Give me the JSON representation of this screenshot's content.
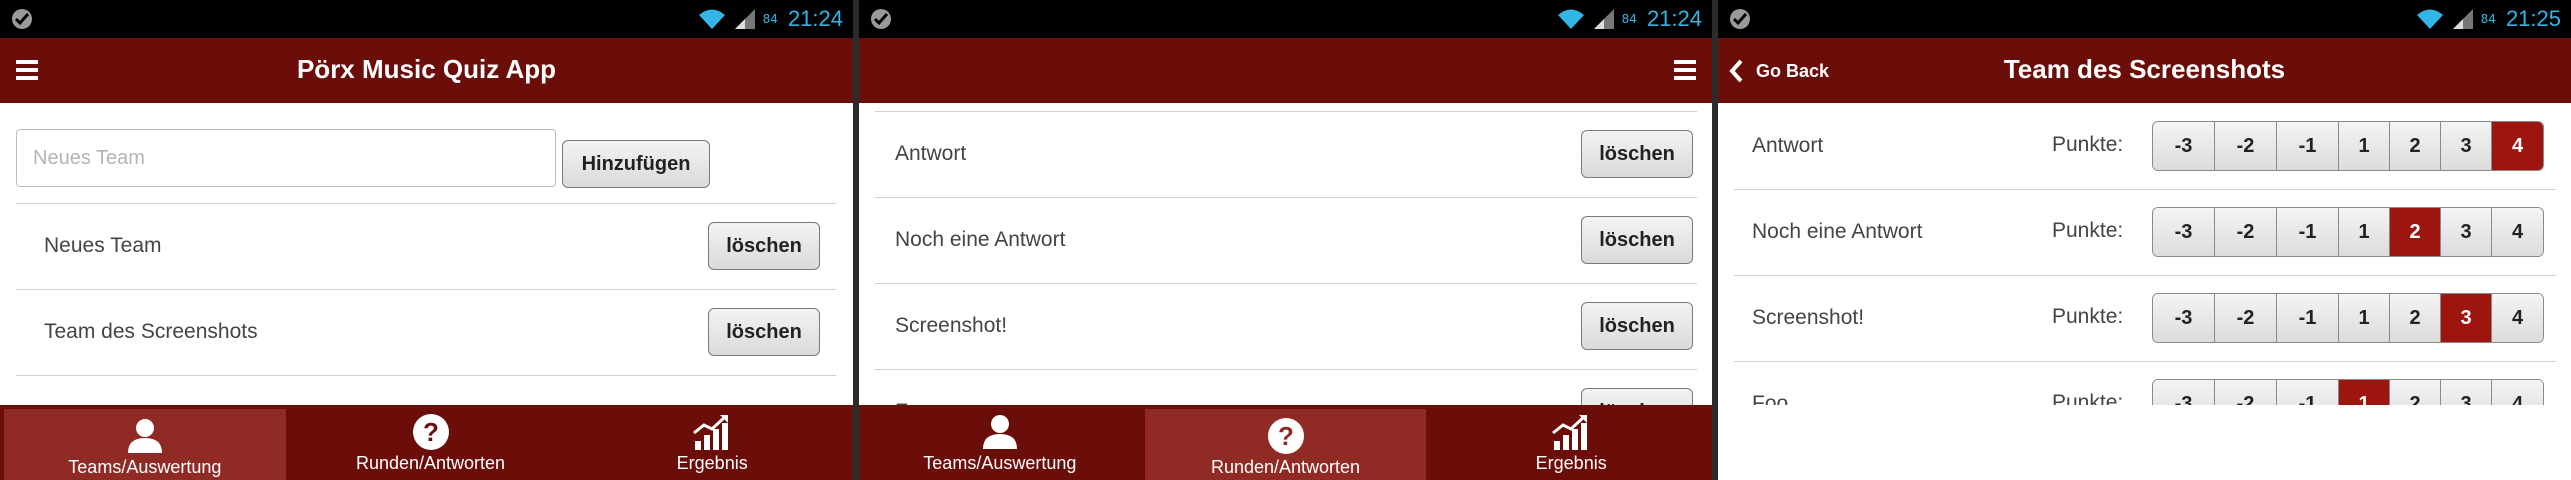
{
  "status": {
    "time1": "21:24",
    "time2": "21:24",
    "time3": "21:25",
    "battery": "84"
  },
  "colors": {
    "primary": "#6b0e0a",
    "active_tab": "#8f2a25",
    "selected_point": "#9c150f",
    "statusbar_text": "#33b5e5"
  },
  "icons": {
    "menu": "hamburger-menu-icon",
    "back": "chevron-left-icon",
    "teams": "person-icon",
    "rounds": "question-circle-icon",
    "results": "trend-chart-icon"
  },
  "screen1": {
    "title": "Pörx Music Quiz App",
    "team_input": {
      "placeholder": "Neues Team",
      "value": ""
    },
    "add_button": "Hinzufügen",
    "teams": [
      {
        "name": "Neues Team",
        "delete": "löschen"
      },
      {
        "name": "Team des Screenshots",
        "delete": "löschen"
      }
    ]
  },
  "screen2": {
    "title": "",
    "answers": [
      {
        "text": "Antwort",
        "delete": "löschen"
      },
      {
        "text": "Noch eine Antwort",
        "delete": "löschen"
      },
      {
        "text": "Screenshot!",
        "delete": "löschen"
      },
      {
        "text": "Foo",
        "delete": "löschen"
      }
    ]
  },
  "screen3": {
    "back_label": "Go Back",
    "title": "Team des Screenshots",
    "points_label": "Punkte:",
    "point_options": [
      "-3",
      "-2",
      "-1",
      "1",
      "2",
      "3",
      "4"
    ],
    "answers": [
      {
        "text": "Antwort",
        "selected": "4"
      },
      {
        "text": "Noch eine Antwort",
        "selected": "2"
      },
      {
        "text": "Screenshot!",
        "selected": "3"
      },
      {
        "text": "Foo",
        "selected": "1"
      }
    ]
  },
  "nav": {
    "items": [
      {
        "label": "Teams/Auswertung"
      },
      {
        "label": "Runden/Antworten"
      },
      {
        "label": "Ergebnis"
      }
    ],
    "active_screen1": "Teams/Auswertung",
    "active_screen2": "Runden/Antworten"
  }
}
